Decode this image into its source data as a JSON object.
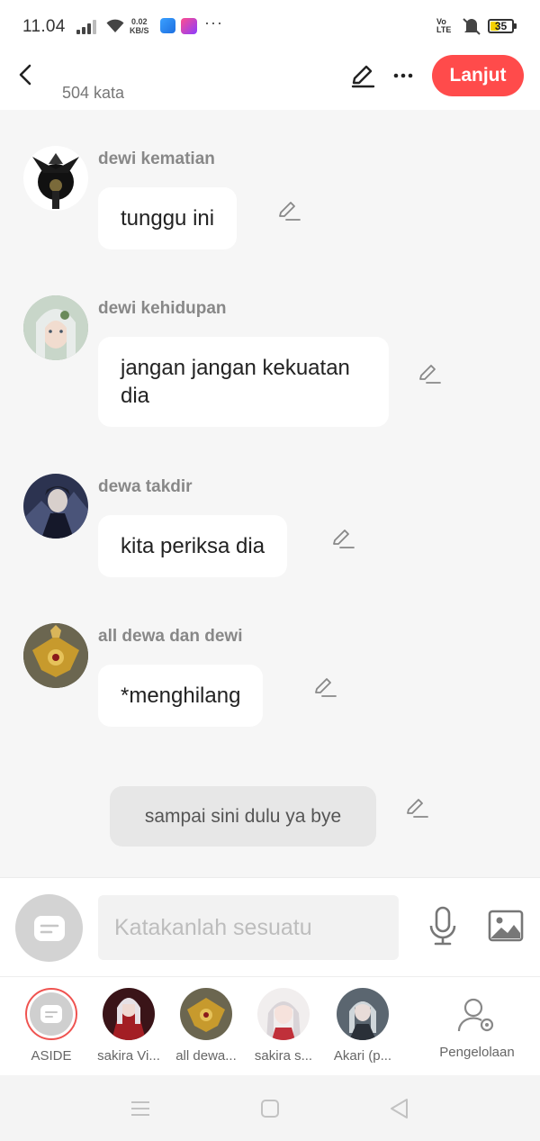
{
  "status": {
    "time": "11.04",
    "speed_value": "0.02",
    "speed_unit": "KB/S",
    "network_label_top": "Vo",
    "network_label_bottom": "LTE",
    "battery": "35",
    "more": "···"
  },
  "header": {
    "word_count": "504 kata",
    "next_label": "Lanjut"
  },
  "messages": [
    {
      "speaker": "dewi kematian",
      "text": "tunggu ini"
    },
    {
      "speaker": "dewi kehidupan",
      "text": "jangan jangan kekuatan dia"
    },
    {
      "speaker": "dewa takdir",
      "text": "kita periksa dia"
    },
    {
      "speaker": "all dewa dan dewi",
      "text": "*menghilang"
    }
  ],
  "narration": {
    "text": "sampai sini dulu ya bye"
  },
  "composer": {
    "placeholder": "Katakanlah sesuatu"
  },
  "characters": [
    {
      "label": "ASIDE"
    },
    {
      "label": "sakira Vi..."
    },
    {
      "label": "all dewa..."
    },
    {
      "label": "sakira s..."
    },
    {
      "label": "Akari (p..."
    }
  ],
  "manage": {
    "label": "Pengelolaan"
  },
  "colors": {
    "accent": "#ff4b4b",
    "background": "#f6f6f6",
    "bubble": "#ffffff"
  }
}
